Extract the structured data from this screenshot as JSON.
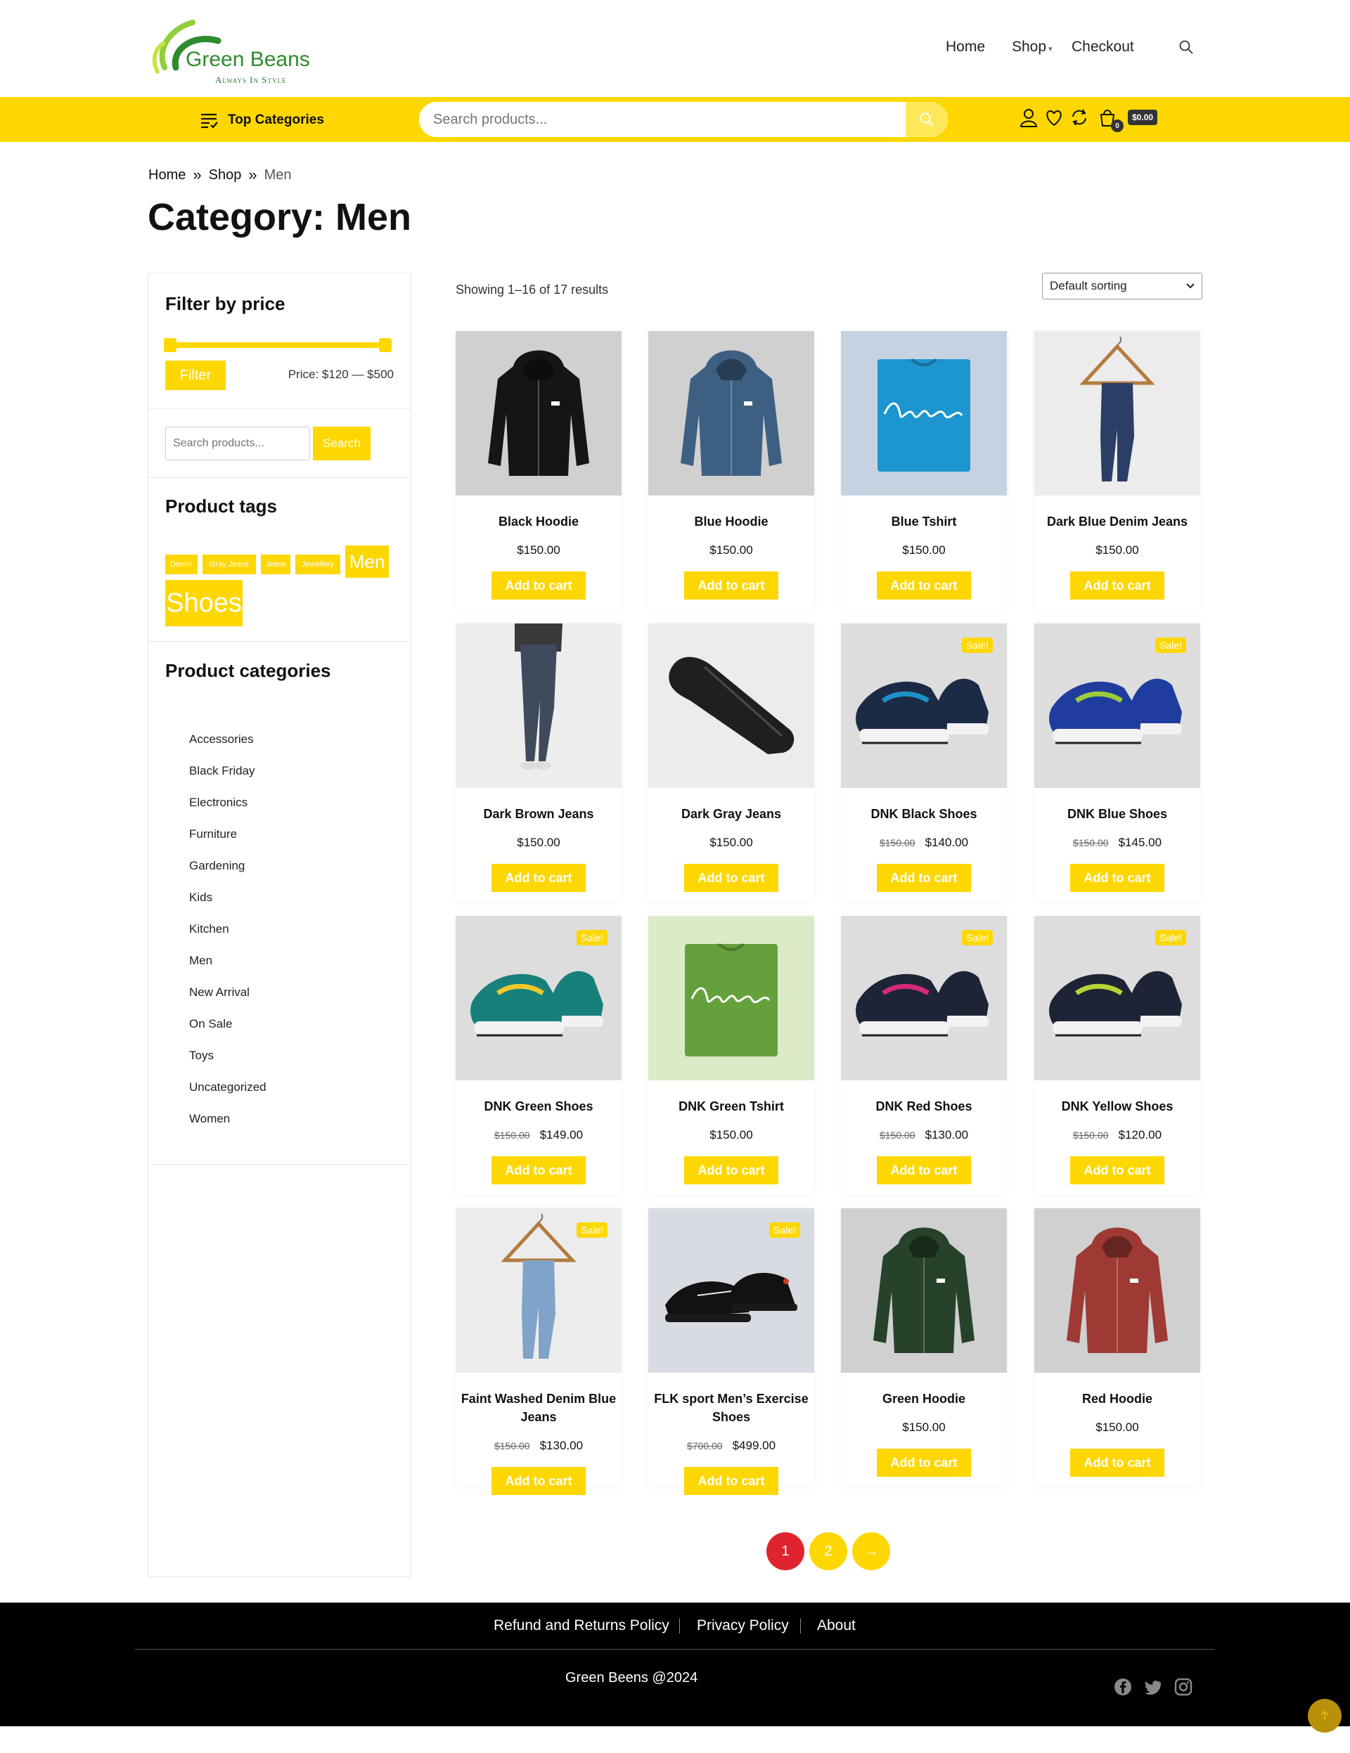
{
  "brand": {
    "name": "Green Beans",
    "tagline": "Always In Style",
    "colors": {
      "accent": "#fed700",
      "brand_green": "#2e8b2e",
      "active_page": "#e0242f"
    }
  },
  "top_nav": {
    "items": [
      {
        "label": "Home"
      },
      {
        "label": "Shop",
        "has_dropdown": true
      },
      {
        "label": "Checkout"
      }
    ],
    "search_icon": "search-icon"
  },
  "toolbar": {
    "top_categories_label": "Top Categories",
    "search_placeholder": "Search products...",
    "icons": [
      "user-icon",
      "heart-icon",
      "refresh-icon",
      "cart-icon"
    ],
    "cart_count": "0",
    "cart_total": "$0.00"
  },
  "breadcrumb": {
    "items": [
      "Home",
      "Shop"
    ],
    "current": "Men"
  },
  "page_title": "Category: Men",
  "sidebar": {
    "price_filter": {
      "title": "Filter by price",
      "button_label": "Filter",
      "range_text": "Price: $120 — $500"
    },
    "search": {
      "placeholder": "Search products...",
      "button_label": "Search"
    },
    "tags": {
      "title": "Product tags",
      "items": [
        "Denim",
        "Gray Jeans",
        "Jeans",
        "Jewellery",
        "Men",
        "Shoes"
      ]
    },
    "categories": {
      "title": "Product categories",
      "items": [
        "Accessories",
        "Black Friday",
        "Electronics",
        "Furniture",
        "Gardening",
        "Kids",
        "Kitchen",
        "Men",
        "New Arrival",
        "On Sale",
        "Toys",
        "Uncategorized",
        "Women"
      ]
    }
  },
  "results": {
    "count_text": "Showing 1–16 of 17 results",
    "sort_selected": "Default sorting"
  },
  "add_to_cart_label": "Add to cart",
  "sale_badge": "Sale!",
  "products": [
    {
      "name": "Black Hoodie",
      "price": "$150.00",
      "old_price": "",
      "sale": false,
      "kind": "hoodie",
      "color": "#151515",
      "bg": "#d0d0d0"
    },
    {
      "name": "Blue Hoodie",
      "price": "$150.00",
      "old_price": "",
      "sale": false,
      "kind": "hoodie",
      "color": "#3d5f82",
      "bg": "#d0d0d0"
    },
    {
      "name": "Blue Tshirt",
      "price": "$150.00",
      "old_price": "",
      "sale": false,
      "kind": "tshirt",
      "color": "#1d95d0",
      "bg": "#c6d2e2"
    },
    {
      "name": "Dark Blue Denim Jeans",
      "price": "$150.00",
      "old_price": "",
      "sale": false,
      "kind": "hanger",
      "color": "#2a3e66",
      "bg": "#ececec"
    },
    {
      "name": "Dark Brown Jeans",
      "price": "$150.00",
      "old_price": "",
      "sale": false,
      "kind": "legs",
      "color": "#3f4a5c",
      "bg": "#ededed"
    },
    {
      "name": "Dark Gray Jeans",
      "price": "$150.00",
      "old_price": "",
      "sale": false,
      "kind": "folded",
      "color": "#1f1f22",
      "bg": "#ececec"
    },
    {
      "name": "DNK Black Shoes",
      "price": "$140.00",
      "old_price": "$150.00",
      "sale": true,
      "kind": "shoe",
      "color": "#1c2b45",
      "accent": "#1e90c8",
      "bg": "#dddddd"
    },
    {
      "name": "DNK Blue Shoes",
      "price": "$145.00",
      "old_price": "$150.00",
      "sale": true,
      "kind": "shoe",
      "color": "#1f3d9e",
      "accent": "#9ccc3a",
      "bg": "#dddddd"
    },
    {
      "name": "DNK Green Shoes",
      "price": "$149.00",
      "old_price": "$150.00",
      "sale": true,
      "kind": "shoe",
      "color": "#17807a",
      "accent": "#f0c82a",
      "bg": "#dddddd"
    },
    {
      "name": "DNK Green Tshirt",
      "price": "$150.00",
      "old_price": "",
      "sale": false,
      "kind": "tshirt",
      "color": "#64a03b",
      "bg": "#dbebc7"
    },
    {
      "name": "DNK Red Shoes",
      "price": "$130.00",
      "old_price": "$150.00",
      "sale": true,
      "kind": "shoe",
      "color": "#1d2435",
      "accent": "#d42a7a",
      "bg": "#dddddd"
    },
    {
      "name": "DNK Yellow Shoes",
      "price": "$120.00",
      "old_price": "$150.00",
      "sale": true,
      "kind": "shoe",
      "color": "#1d2435",
      "accent": "#b6d436",
      "bg": "#dddddd"
    },
    {
      "name": "Faint Washed Denim Blue Jeans",
      "price": "$130.00",
      "old_price": "$150.00",
      "sale": true,
      "kind": "hanger",
      "color": "#7fa3c9",
      "bg": "#ececec"
    },
    {
      "name": "FLK sport Men’s Exercise Shoes",
      "price": "$499.00",
      "old_price": "$700.00",
      "sale": true,
      "kind": "sneaker",
      "color": "#121212",
      "accent": "#d03a2a",
      "bg": "#d9dbe3"
    },
    {
      "name": "Green Hoodie",
      "price": "$150.00",
      "old_price": "",
      "sale": false,
      "kind": "hoodie",
      "color": "#26422a",
      "bg": "#d0d0d0"
    },
    {
      "name": "Red Hoodie",
      "price": "$150.00",
      "old_price": "",
      "sale": false,
      "kind": "hoodie",
      "color": "#9e3a33",
      "bg": "#d0d0d0"
    }
  ],
  "pagination": {
    "pages": [
      "1",
      "2"
    ],
    "current": "1",
    "next": "→"
  },
  "footer": {
    "links": [
      "Refund and Returns Policy",
      "Privacy Policy",
      "About"
    ],
    "copyright": "Green Beens @2024",
    "social": [
      "facebook-icon",
      "twitter-icon",
      "instagram-icon"
    ],
    "back_to_top_icon": "arrow-up-icon"
  }
}
